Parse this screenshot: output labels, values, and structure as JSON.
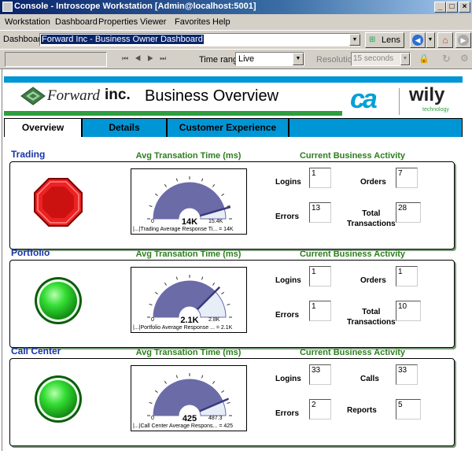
{
  "window": {
    "title": "Console - Introscope Workstation [Admin@localhost:5001]"
  },
  "menu": [
    "Workstation",
    "Dashboard",
    "Properties",
    "Viewer",
    "Favorites",
    "Help"
  ],
  "dashbar": {
    "label": "Dashboard:",
    "value": "Forward Inc - Business Owner Dashboard",
    "lens": "Lens"
  },
  "controls": {
    "time_range_label": "Time range:",
    "time_range_value": "Live",
    "resolution_label": "Resolution:",
    "resolution_value": "15 seconds"
  },
  "header": {
    "brand": "Forward",
    "brand_suffix": "inc.",
    "title": "Business Overview",
    "logo_ca": "ca",
    "logo_wily": "wily",
    "logo_wily_sub": "technology"
  },
  "tabs": [
    "Overview",
    "Details",
    "Customer Experience"
  ],
  "colors": {
    "accent_blue": "#0096d6",
    "accent_green": "#2e9e3e",
    "gauge_fill": "#6b6ba8",
    "status_red": "#cc1111",
    "status_green": "#22bb22"
  },
  "sections": [
    {
      "title": "Trading",
      "gauge_title": "Avg Transation Time (ms)",
      "activity_title": "Current Business Activity",
      "status": "red",
      "gauge": {
        "min": "0",
        "max": "15.4K",
        "value": "14K",
        "fraction": 0.91,
        "caption": "|...|Trading Average Response Ti... = 14K"
      },
      "metrics": [
        {
          "label": "Logins",
          "value": "1"
        },
        {
          "label": "Orders",
          "value": "7"
        },
        {
          "label": "Errors",
          "value": "13"
        },
        {
          "label": "Total\nTransactions",
          "value": "28"
        }
      ]
    },
    {
      "title": "Portfolio",
      "gauge_title": "Avg Transation Time (ms)",
      "activity_title": "Current Business Activity",
      "status": "green",
      "gauge": {
        "min": "0",
        "max": "2.8K",
        "value": "2.1K",
        "fraction": 0.75,
        "caption": "|...|Portfolio Average Response ... = 2.1K"
      },
      "metrics": [
        {
          "label": "Logins",
          "value": "1"
        },
        {
          "label": "Orders",
          "value": "1"
        },
        {
          "label": "Errors",
          "value": "1"
        },
        {
          "label": "Total\nTransactions",
          "value": "10"
        }
      ]
    },
    {
      "title": "Call Center",
      "gauge_title": "Avg Transation Time (ms)",
      "activity_title": "Current Business Activity",
      "status": "green",
      "gauge": {
        "min": "0",
        "max": "487.3",
        "value": "425",
        "fraction": 0.87,
        "caption": "|...|Call Center Average Respons... = 425"
      },
      "metrics": [
        {
          "label": "Logins",
          "value": "33"
        },
        {
          "label": "Calls",
          "value": "33"
        },
        {
          "label": "Errors",
          "value": "2"
        },
        {
          "label": "Reports",
          "value": "5"
        }
      ]
    }
  ]
}
